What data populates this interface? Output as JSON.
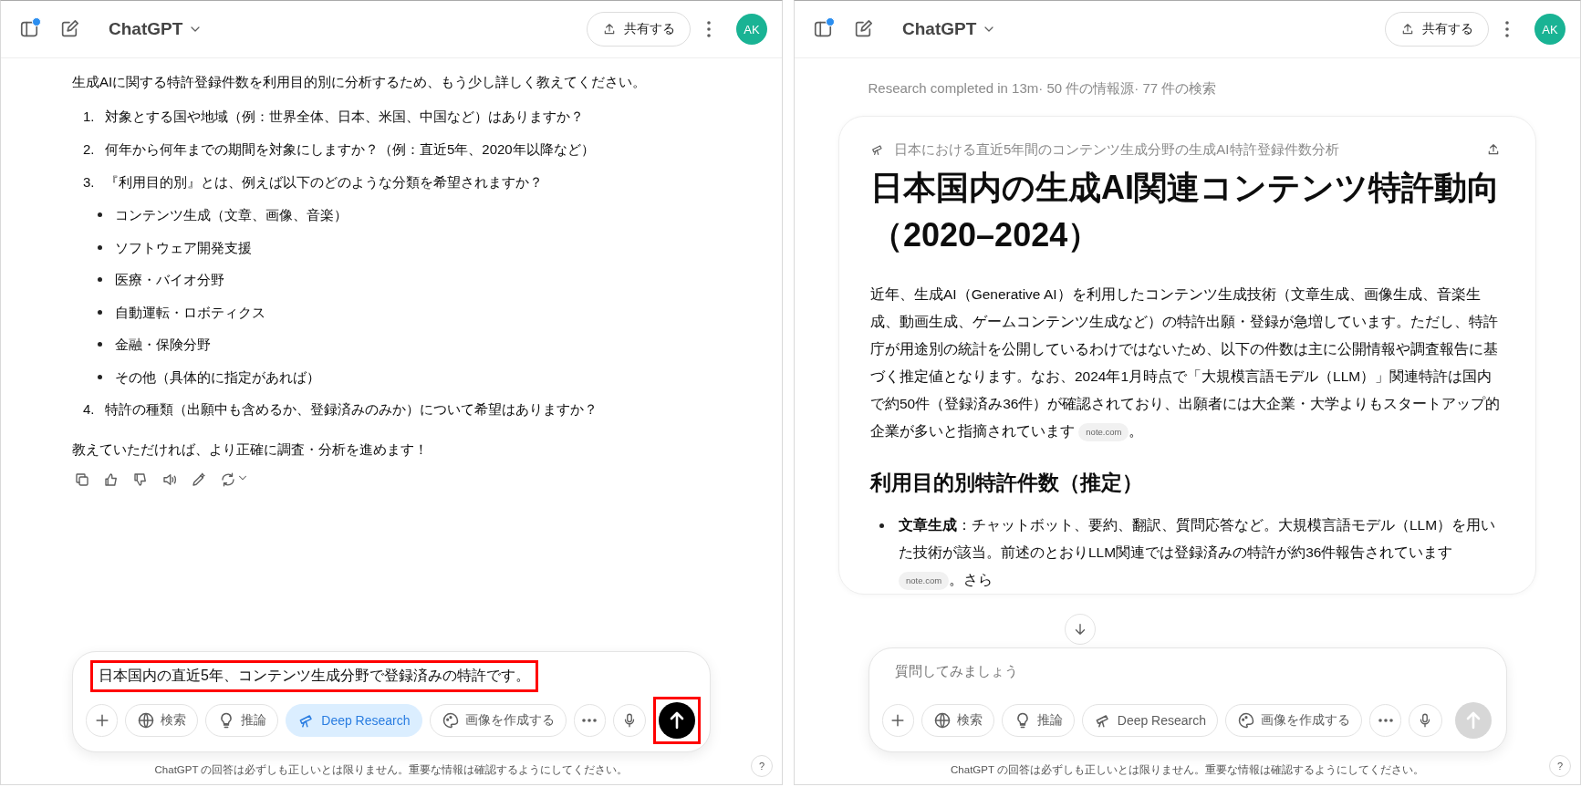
{
  "left_pane": {
    "header": {
      "notification": true,
      "title": "ChatGPT",
      "share": "共有する",
      "avatar": "AK"
    },
    "message": {
      "intro": "生成AIに関する特許登録件数を利用目的別に分析するため、もう少し詳しく教えてください。",
      "questions": [
        {
          "number": "1.",
          "text": "対象とする国や地域（例：世界全体、日本、米国、中国など）はありますか？"
        },
        {
          "number": "2.",
          "text": "何年から何年までの期間を対象にしますか？（例：直近5年、2020年以降など）"
        },
        {
          "number": "3.",
          "text": "『利用目的別』とは、例えば以下のどのような分類を希望されますか？",
          "children": [
            "コンテンツ生成（文章、画像、音楽）",
            "ソフトウェア開発支援",
            "医療・バイオ分野",
            "自動運転・ロボティクス",
            "金融・保険分野",
            "その他（具体的に指定があれば）"
          ]
        },
        {
          "number": "4.",
          "text": "特許の種類（出願中も含めるか、登録済みのみか）について希望はありますか？"
        }
      ],
      "closing": "教えていただければ、より正確に調査・分析を進めます！",
      "actions": [
        {
          "kind": "copy"
        },
        {
          "kind": "like"
        },
        {
          "kind": "dislike"
        },
        {
          "kind": "speaker"
        },
        {
          "kind": "edit"
        },
        {
          "kind": "regenerate"
        }
      ]
    },
    "composer": {
      "value": "日本国内の直近5年、コンテンツ生成分野で登録済みの特許です。",
      "annotated": true,
      "tools": [
        {
          "kind": "plus"
        },
        {
          "kind": "globe",
          "label": "検索",
          "selected": false
        },
        {
          "kind": "bulb",
          "label": "推論",
          "selected": false
        },
        {
          "kind": "telescope",
          "label": "Deep Research",
          "selected": true
        },
        {
          "kind": "palette",
          "label": "画像を作成する",
          "selected": false
        },
        {
          "kind": "more"
        }
      ],
      "send_enabled": true,
      "send_annotated": true
    },
    "disclaimer": "ChatGPT の回答は必ずしも正しいとは限りません。重要な情報は確認するようにしてください。",
    "help": "?"
  },
  "right_pane": {
    "header": {
      "notification": true,
      "title": "ChatGPT",
      "share": "共有する",
      "avatar": "AK"
    },
    "research_status": "Research completed in 13m· 50 件の情報源· 77 件の検索",
    "report": {
      "subtitle": "日本における直近5年間のコンテンツ生成分野の生成AI特許登録件数分析",
      "title": "日本国内の生成AI関連コンテンツ特許動向（2020–2024）",
      "paragraph": {
        "text": "近年、生成AI（Generative AI）を利用したコンテンツ生成技術（文章生成、画像生成、音楽生成、動画生成、ゲームコンテンツ生成など）の特許出願・登録が急増しています。ただし、特許庁が用途別の統計を公開しているわけではないため、以下の件数は主に公開情報や調査報告に基づく推定値となります。なお、2024年1月時点で「大規模言語モデル（LLM）」関連特許は国内で約50件（登録済み36件）が確認されており、出願者には大企業・大学よりもスタートアップ的企業が多いと指摘されています",
        "citation": "note.com",
        "tail": "。"
      },
      "section_heading": "利用目的別特許件数（推定）",
      "bullets": [
        {
          "text": "**文章生成**：チャットボット、要約、翻訳、質問応答など。大規模言語モデル（LLM）を用いた技術が該当。前述のとおりLLM関連では登録済みの特許が約36件報告されています",
          "citation": "note.com",
          "tail": "。さら"
        }
      ]
    },
    "composer": {
      "placeholder": "質問してみましょう",
      "tools": [
        {
          "kind": "plus"
        },
        {
          "kind": "globe",
          "label": "検索",
          "selected": false
        },
        {
          "kind": "bulb",
          "label": "推論",
          "selected": false
        },
        {
          "kind": "telescope",
          "label": "Deep Research",
          "selected": false
        },
        {
          "kind": "palette",
          "label": "画像を作成する",
          "selected": false
        },
        {
          "kind": "more"
        }
      ],
      "send_enabled": false
    },
    "disclaimer": "ChatGPT の回答は必ずしも正しいとは限りません。重要な情報は確認するようにしてください。",
    "help": "?"
  }
}
